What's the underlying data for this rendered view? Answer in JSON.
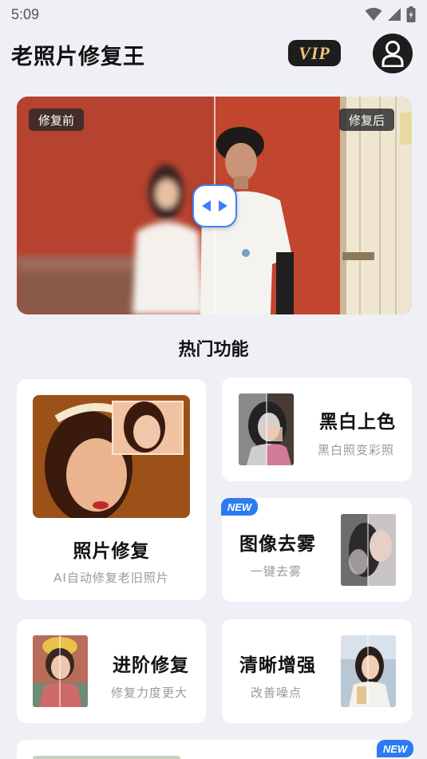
{
  "status_bar": {
    "time": "5:09"
  },
  "header": {
    "title": "老照片修复王",
    "vip_label": "VIP"
  },
  "compare": {
    "before_label": "修复前",
    "after_label": "修复后"
  },
  "section": {
    "title": "热门功能"
  },
  "cards": {
    "photo_repair": {
      "title": "照片修复",
      "subtitle": "AI自动修复老旧照片"
    },
    "colorize": {
      "title": "黑白上色",
      "subtitle": "黑白照变彩照"
    },
    "dehaze": {
      "title": "图像去雾",
      "subtitle": "一键去雾",
      "badge": "NEW"
    },
    "advanced": {
      "title": "进阶修复",
      "subtitle": "修复力度更大"
    },
    "enhance": {
      "title": "清晰增强",
      "subtitle": "改善噪点"
    },
    "bottom": {
      "badge": "NEW"
    }
  },
  "colors": {
    "accent": "#3d7ff5",
    "new_badge": "#2c7bf2",
    "vip_gold": "#f0c37a"
  },
  "icons": [
    "wifi-icon",
    "signal-icon",
    "battery-icon",
    "user-icon",
    "arrow-left-icon",
    "arrow-right-icon"
  ]
}
